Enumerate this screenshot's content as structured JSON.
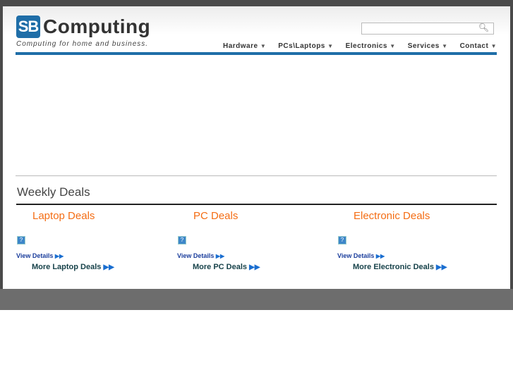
{
  "brand": {
    "logo_initials": "SB",
    "name": "Computing",
    "tagline": "Computing for home and business."
  },
  "search": {
    "placeholder": "",
    "icon": "search-icon"
  },
  "nav": [
    {
      "label": "Hardware"
    },
    {
      "label": "PCs\\Laptops"
    },
    {
      "label": "Electronics"
    },
    {
      "label": "Services"
    },
    {
      "label": "Contact"
    }
  ],
  "weekly": {
    "title": "Weekly Deals",
    "columns": [
      {
        "title": "Laptop Deals",
        "view": "View Details",
        "more": "More Laptop Deals"
      },
      {
        "title": "PC Deals",
        "view": "View Details",
        "more": "More PC Deals"
      },
      {
        "title": "Electronic Deals",
        "view": "View Details",
        "more": "More Electronic Deals"
      }
    ]
  },
  "colors": {
    "brand_blue": "#1f6ea8",
    "deal_orange": "#f46d14"
  }
}
